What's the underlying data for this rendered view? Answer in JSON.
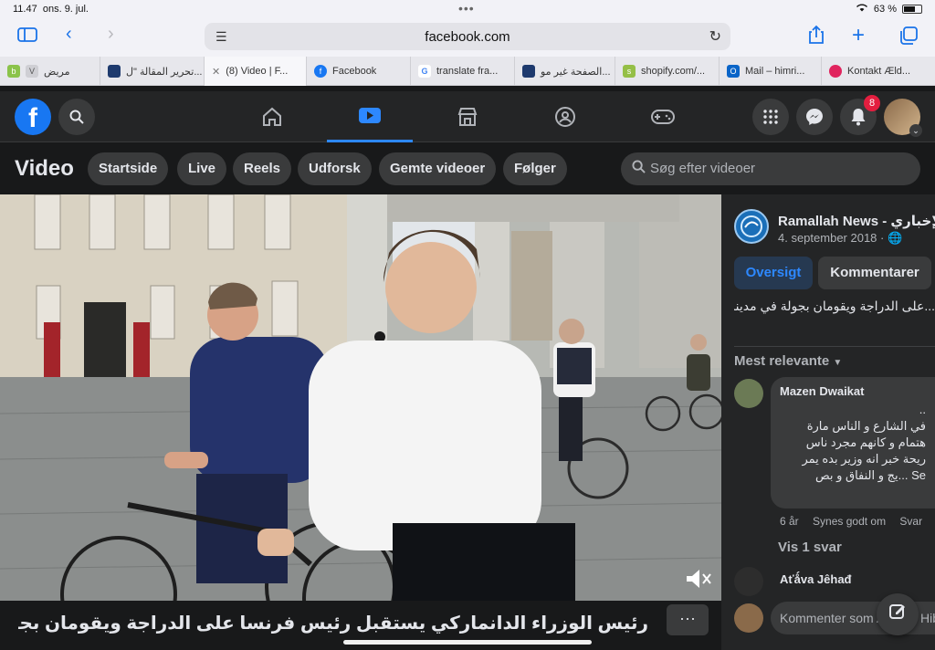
{
  "status": {
    "time": "11.47",
    "date": "ons. 9. jul.",
    "battery": "63 %"
  },
  "safari": {
    "url": "facebook.com"
  },
  "tabs": [
    {
      "label": "مريض",
      "fav_color": "#8bc34a"
    },
    {
      "label": "تحرير المقالة \"ل...",
      "fav_color": "#1e3a6e"
    },
    {
      "label": "(8) Video | F...",
      "fav_color": "#777777"
    },
    {
      "label": "Facebook",
      "fav_color": "#1877f2"
    },
    {
      "label": "translate fra...",
      "fav_color": "#ffffff"
    },
    {
      "label": "الصفحة غير مو...",
      "fav_color": "#1e3a6e"
    },
    {
      "label": "shopify.com/...",
      "fav_color": "#95bf47"
    },
    {
      "label": "Mail – himri...",
      "fav_color": "#0a64c8"
    },
    {
      "label": "Kontakt Æld...",
      "fav_color": "#e0245e"
    }
  ],
  "fb": {
    "notifications_count": "8",
    "page_title": "Video",
    "subnav": [
      "Startside",
      "Live",
      "Reels",
      "Udforsk",
      "Gemte videoer",
      "Følger"
    ],
    "search_placeholder": "Søg efter videoer"
  },
  "video": {
    "caption": "رئيس الوزراء الدانماركي يستقبل رئيس فرنسا على الدراجة ويقومان بجولة في مدينة ...",
    "more_label": "···"
  },
  "side": {
    "page_name": "Ramallah News - الإخباري",
    "date": "4. september 2018 · ",
    "btn_overview": "Oversigt",
    "btn_comments": "Kommentarer",
    "description": "...على الدراجة ويقومان بجولة في مدينة",
    "sort": "Mest relevante",
    "comment": {
      "author": "Mazen Dwaikat",
      "lines": [
        "..",
        "في الشارع و الناس مارة",
        "هتمام و كانهم مجرد ناس",
        "ريحة خبر انه وزير بده يمر",
        "Se ...يج و النفاق و بص"
      ],
      "age": "6 år",
      "like": "Synes godt om",
      "reply": "Svar"
    },
    "view_replies": "Vis 1 svar",
    "comment2_author": "Aťǻva Jêhađ",
    "comment_input": "Kommenter som Ahmad Hibri"
  }
}
